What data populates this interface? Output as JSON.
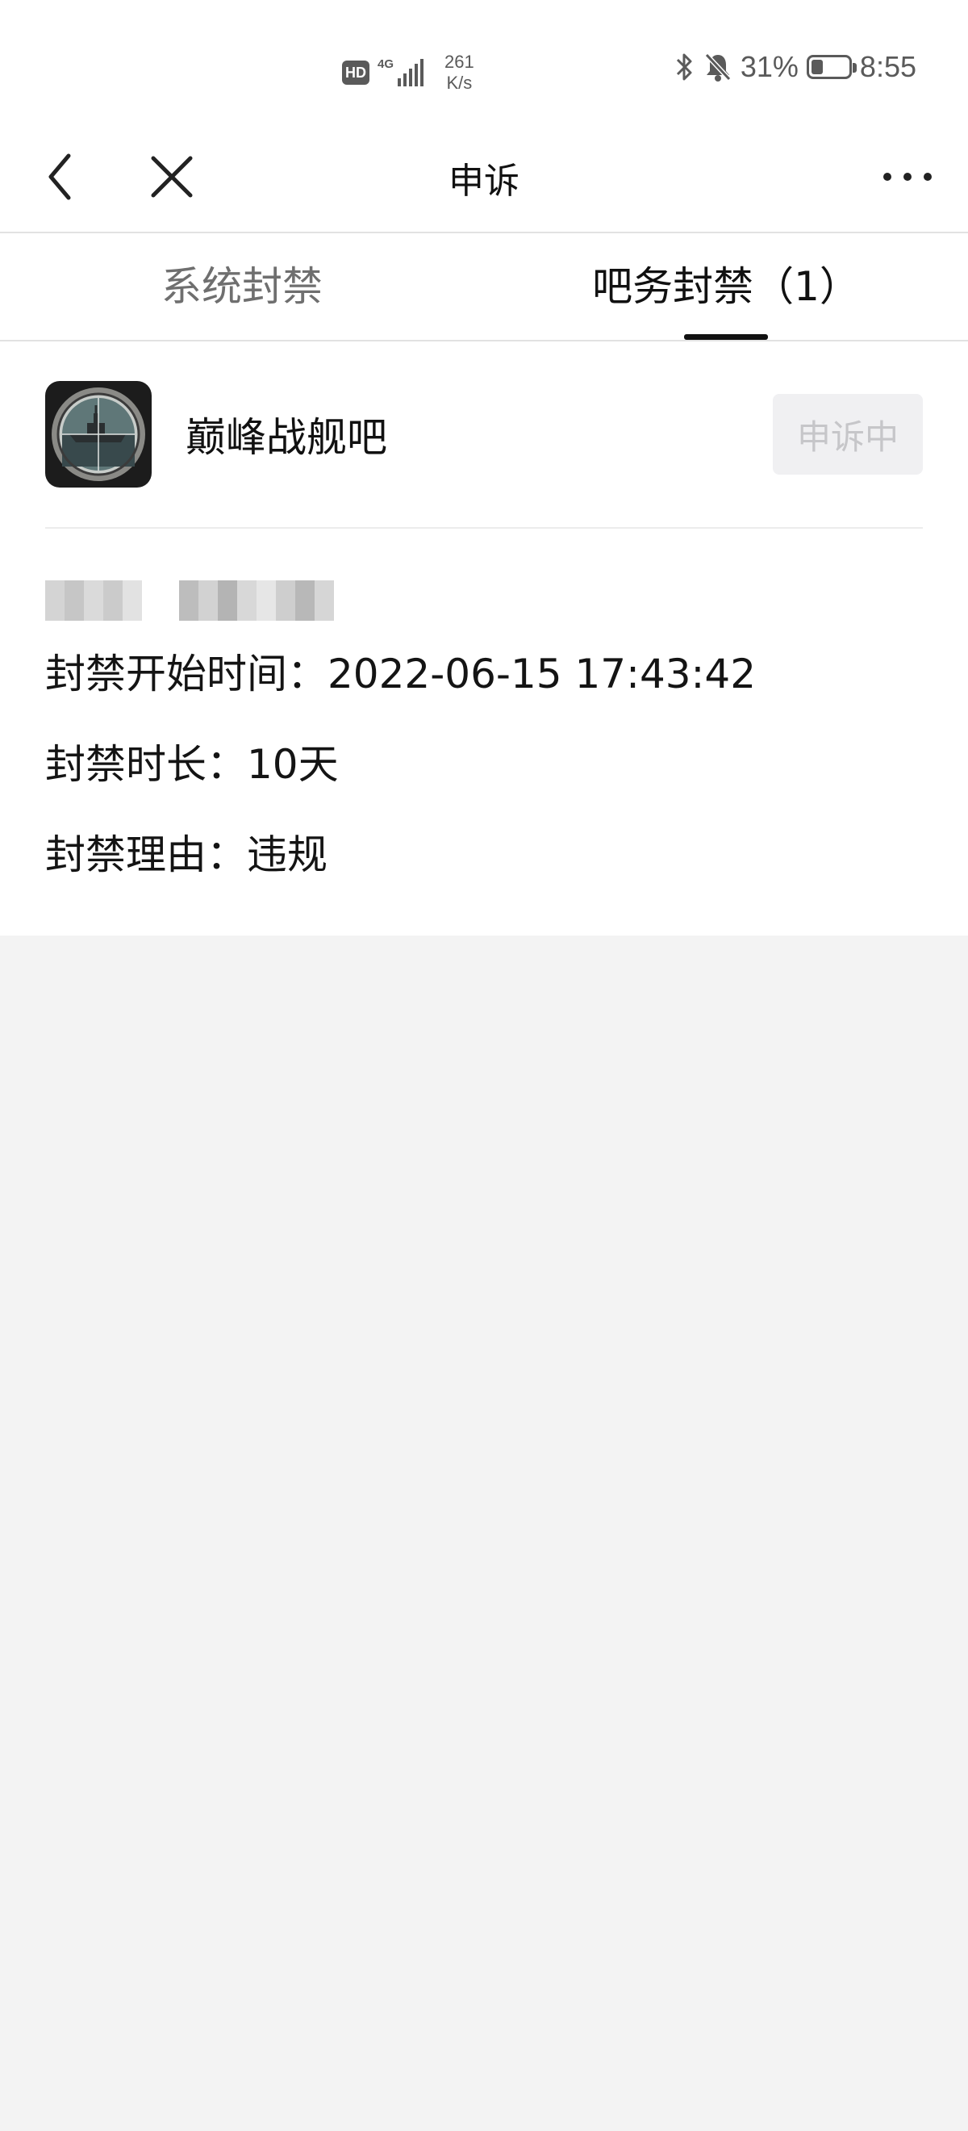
{
  "status_bar": {
    "hd": "HD",
    "network": "4G",
    "speed_value": "261",
    "speed_unit": "K/s",
    "battery_percent": "31%",
    "battery_level": 0.31,
    "time": "8:55"
  },
  "header": {
    "title": "申诉"
  },
  "tabs": [
    {
      "label": "系统封禁"
    },
    {
      "label": "吧务封禁（1）"
    }
  ],
  "ban": {
    "forum_name": "巅峰战舰吧",
    "appeal_status": "申诉中",
    "start_label": "封禁开始时间：",
    "start_time": "2022-06-15 17:43:42",
    "duration_label": "封禁时长：",
    "duration": "10天",
    "reason_label": "封禁理由：",
    "reason": "违规"
  },
  "colors": {
    "accent": "#111111",
    "background": "#f3f3f3",
    "muted_text": "#6f6f6f",
    "disabled_text": "#c6c6c9"
  }
}
